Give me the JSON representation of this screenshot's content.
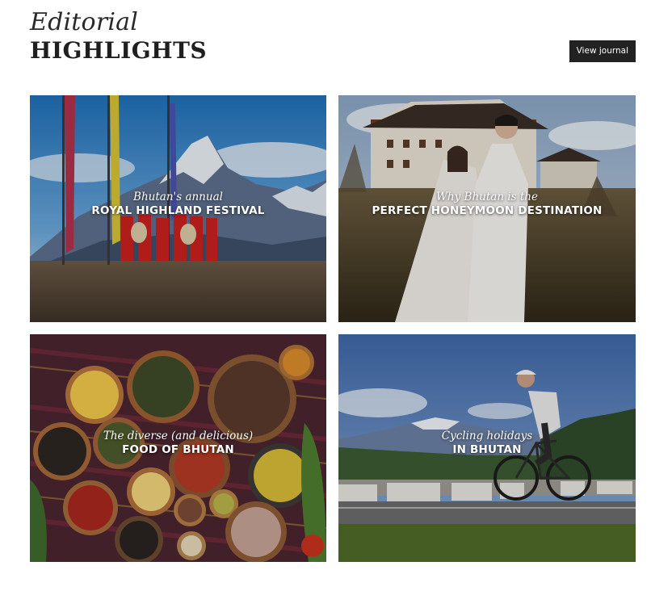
{
  "header": {
    "eyebrow": "Editorial",
    "title": "HIGHLIGHTS",
    "button_label": "View journal"
  },
  "cards": [
    {
      "subtitle": "Bhutan's annual",
      "title": "ROYAL HIGHLAND FESTIVAL",
      "image": "mountain-festival-photo"
    },
    {
      "subtitle": "Why Bhutan is the",
      "title": "PERFECT HONEYMOON DESTINATION",
      "image": "couple-at-dzong-photo"
    },
    {
      "subtitle": "The diverse (and delicious)",
      "title": "FOOD OF BHUTAN",
      "image": "food-spread-photo"
    },
    {
      "subtitle": "Cycling holidays",
      "title": "IN BHUTAN",
      "image": "cyclist-road-photo"
    }
  ],
  "colors": {
    "button_bg": "#222222",
    "text_dark": "#1f1f1f"
  }
}
